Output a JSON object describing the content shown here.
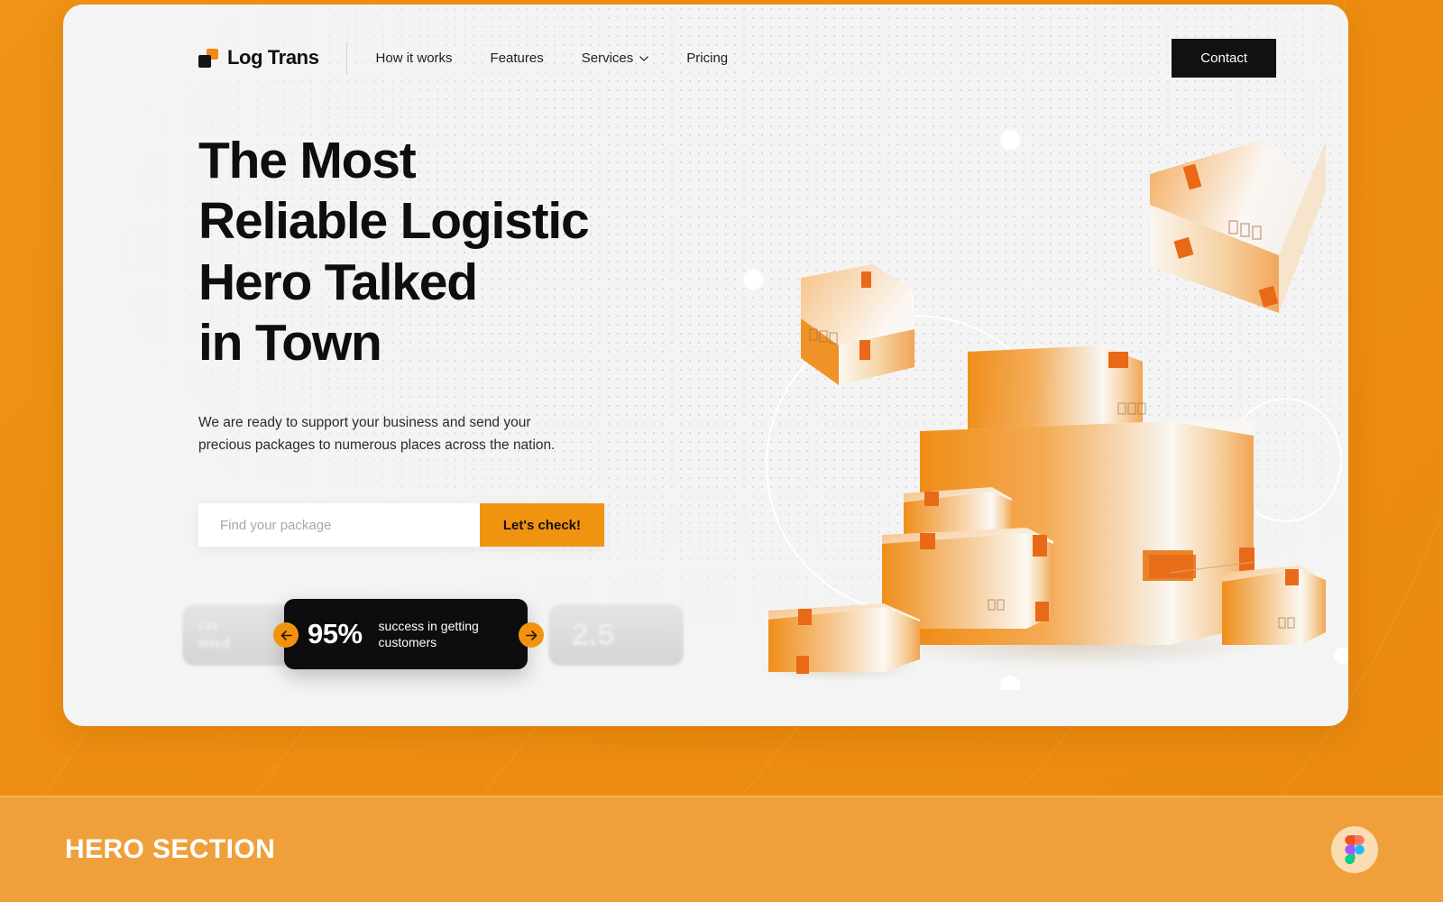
{
  "theme": {
    "brand_orange": "#f0930f",
    "page_background": "#ef8f14",
    "card_background": "#f4f4f4",
    "ink": "#0e0e0e",
    "footer_background": "#f0a03a"
  },
  "nav": {
    "logo_text": "Log Trans",
    "logo_mark_icon": "two-squares-logo-icon",
    "links": [
      {
        "label": "How it works",
        "has_dropdown": false
      },
      {
        "label": "Features",
        "has_dropdown": false
      },
      {
        "label": "Services",
        "has_dropdown": true,
        "icon": "chevron-down-icon"
      },
      {
        "label": "Pricing",
        "has_dropdown": false
      }
    ],
    "contact_label": "Contact"
  },
  "hero": {
    "headline": "The Most\nReliable Logistic\nHero Talked\nin Town",
    "subtext": "We are ready to support your business and send your\nprecious packages to numerous places across the nation.",
    "search": {
      "placeholder": "Find your package",
      "value": "",
      "button_label": "Let's check!"
    }
  },
  "stats": {
    "prev_card": {
      "text": "cts\nleted",
      "icon": "blurred-stat-card"
    },
    "active_card": {
      "value": "95%",
      "label": "success in getting\ncustomers"
    },
    "next_card": {
      "value": "2.5",
      "icon": "blurred-stat-card"
    },
    "prev_arrow_icon": "arrow-left-icon",
    "next_arrow_icon": "arrow-right-icon"
  },
  "illustration": {
    "name": "stacked-cardboard-packages-illustration",
    "elements": [
      "floating-box-top-right",
      "floating-box-left",
      "large-center-box",
      "medium-box",
      "small-boxes",
      "white-circle-outlines",
      "white-dots"
    ]
  },
  "footer": {
    "section_label": "HERO SECTION",
    "badge_icon": "figma-logo-icon"
  }
}
